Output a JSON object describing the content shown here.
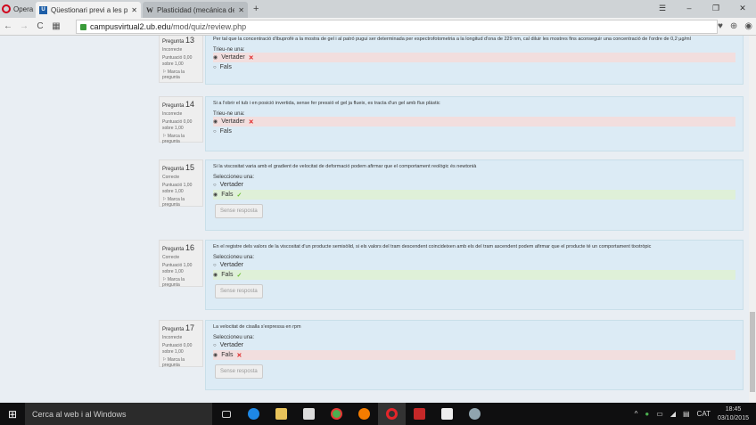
{
  "browser": {
    "name": "Opera",
    "tabs": [
      {
        "title": "Qüestionari previ a les pràctiques",
        "active": true
      },
      {
        "title": "Plasticidad (mecánica de sólidos)",
        "active": false
      }
    ],
    "url_host": "campusvirtual2.ub.edu",
    "url_path": "/mod/quiz/review.php"
  },
  "questions": [
    {
      "label": "Pregunta",
      "num": "13",
      "state": "Incorrecte",
      "score": "Puntuació 0,00 sobre 1,00",
      "flag": "Marca la pregunta",
      "text": "Per tal que la concentració d'ibuprofè a la mostra de gel i al patró pugui ser determinada per espectrofotometria a la longitud d'ona de 229 nm, cal diluir les mostres fins aconseguir una concentració de l'ordre de 0,2 µg/ml",
      "prompt": "Trieu-ne una:",
      "options": [
        "Vertader",
        "Fals"
      ],
      "selected": 0,
      "result": "wrong",
      "button": ""
    },
    {
      "label": "Pregunta",
      "num": "14",
      "state": "Incorrecte",
      "score": "Puntuació 0,00 sobre 1,00",
      "flag": "Marca la pregunta",
      "text": "Si a l'obrir el tub i en posició invertida, sense fer pressió el gel ja flueix, es tracta d'un gel amb flux plàstic",
      "prompt": "Trieu-ne una:",
      "options": [
        "Vertader",
        "Fals"
      ],
      "selected": 0,
      "result": "wrong",
      "button": ""
    },
    {
      "label": "Pregunta",
      "num": "15",
      "state": "Correcte",
      "score": "Puntuació 1,00 sobre 1,00",
      "flag": "Marca la pregunta",
      "text": "Si la viscositat varia amb el gradient de velocitat de deformació podem afirmar que el comportament reològic és newtonià",
      "prompt": "Seleccioneu una:",
      "options": [
        "Vertader",
        "Fals"
      ],
      "selected": 1,
      "result": "right",
      "button": "Sense resposta"
    },
    {
      "label": "Pregunta",
      "num": "16",
      "state": "Correcte",
      "score": "Puntuació 1,00 sobre 1,00",
      "flag": "Marca la pregunta",
      "text": "En el registre dels valors de la viscositat d'un producte semisòlid, si els valors del tram descendent coincideixen amb els del tram ascendent podem afirmar que el producte té un comportament tixotròpic",
      "prompt": "Seleccioneu una:",
      "options": [
        "Vertader",
        "Fals"
      ],
      "selected": 1,
      "result": "right",
      "button": "Sense resposta"
    },
    {
      "label": "Pregunta",
      "num": "17",
      "state": "Incorrecte",
      "score": "Puntuació 0,00 sobre 1,00",
      "flag": "Marca la pregunta",
      "text": "La velocitat de cisalla s'expressa en rpm",
      "prompt": "Seleccioneu una:",
      "options": [
        "Vertader",
        "Fals"
      ],
      "selected": 1,
      "result": "wrong",
      "button": "Sense resposta"
    }
  ],
  "taskbar": {
    "search_placeholder": "Cerca al web i al Windows",
    "language": "CAT",
    "time": "18:45",
    "date": "03/10/2015"
  }
}
